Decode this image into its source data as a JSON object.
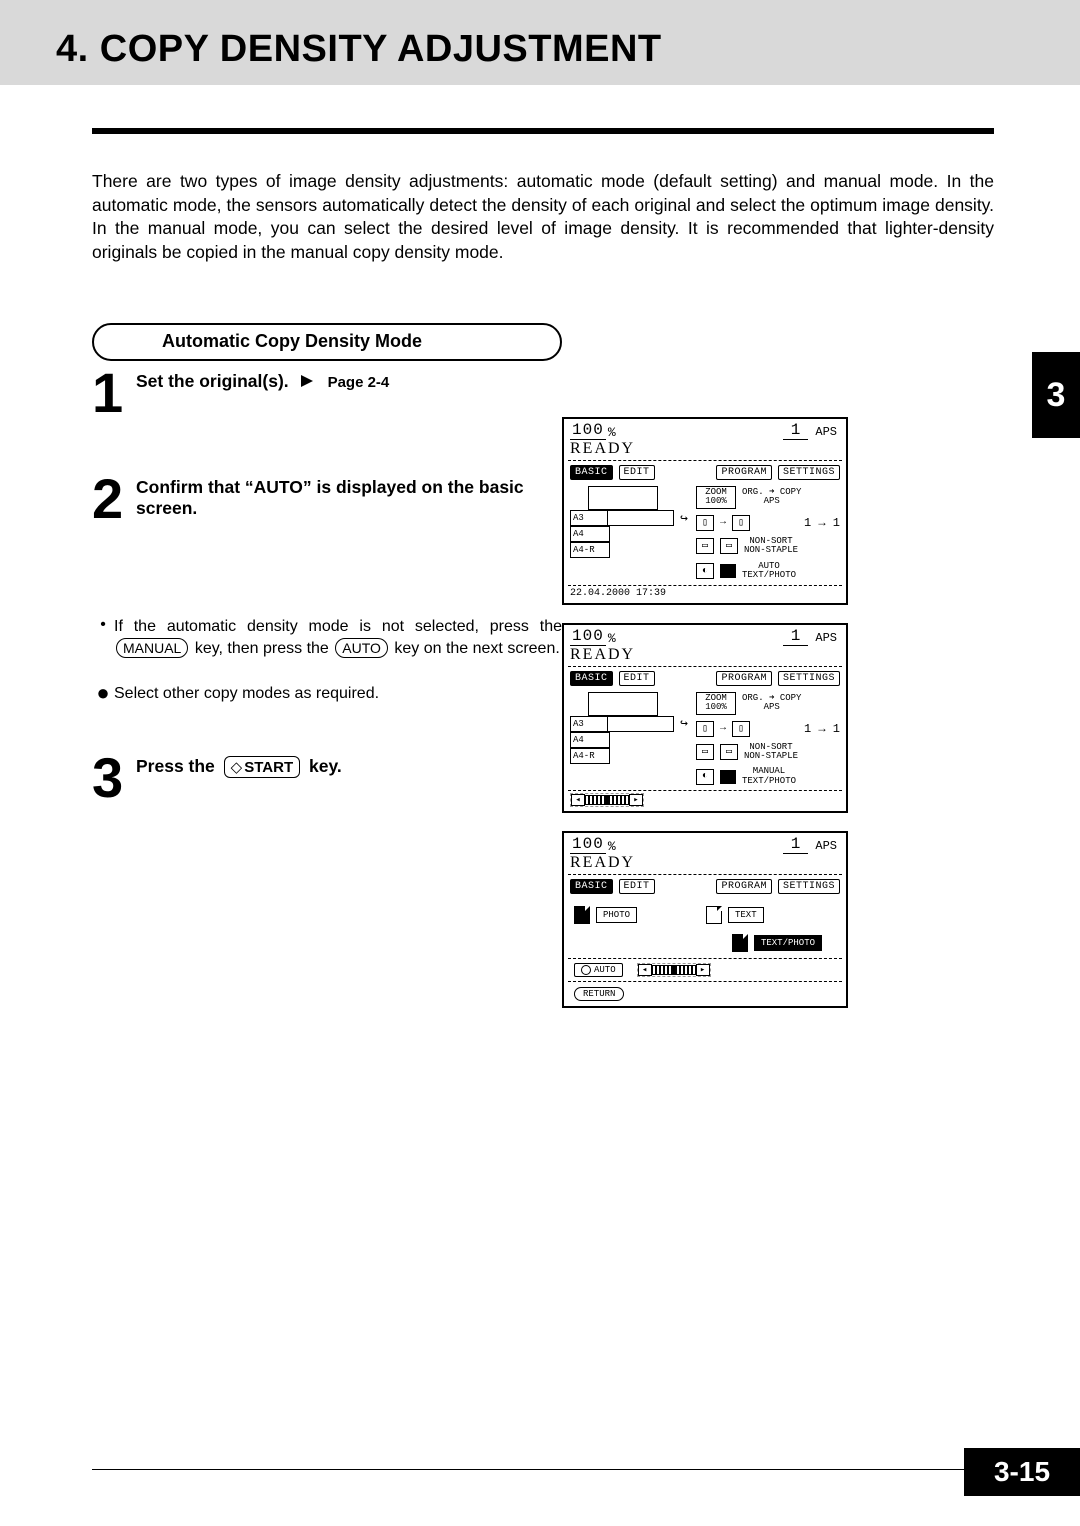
{
  "chapter_tab": "3",
  "page_number": "3-15",
  "title": "4. COPY DENSITY ADJUSTMENT",
  "intro": "There are two types of image density adjustments: automatic mode (default setting) and manual mode. In the automatic mode, the sensors automatically detect the density of each original and select the optimum image density. In the manual mode, you can select the desired level of image density. It is recommended that lighter-density originals be copied in the manual copy density mode.",
  "section_heading": "Automatic Copy Density Mode",
  "steps": {
    "s1": {
      "num": "1",
      "text": "Set the original(s).",
      "page_ref": "Page 2-4"
    },
    "s2": {
      "num": "2",
      "text": "Confirm that “AUTO” is displayed on the basic screen."
    },
    "s3": {
      "num": "3",
      "prefix": "Press the",
      "key": "START",
      "suffix": "key."
    }
  },
  "bullets": {
    "b1_a": "If the automatic density mode is not selected, press the",
    "b1_key1": "MANUAL",
    "b1_mid": "key, then press the",
    "b1_key2": "AUTO",
    "b1_b": "key on the next screen.",
    "b2": "Select other copy modes as required."
  },
  "screen_common": {
    "zoom": "100",
    "pct": "%",
    "count": "1",
    "aps": "APS",
    "ready": "READY",
    "tabs": {
      "basic": "BASIC",
      "edit": "EDIT",
      "program": "PROGRAM",
      "settings": "SETTINGS"
    },
    "trays": {
      "a3": "A3",
      "a4": "A4",
      "a4r": "A4-R"
    },
    "opts": {
      "zoom": "ZOOM\n100%",
      "org": "ORG. ➜ COPY\nAPS",
      "oneone_a": "1",
      "oneone_arrow": "→",
      "oneone_b": "1",
      "nonsort": "NON-SORT\nNON-STAPLE",
      "auto": "AUTO\nTEXT/PHOTO",
      "manual": "MANUAL\nTEXT/PHOTO"
    },
    "datetime": "22.04.2000 17:39"
  },
  "screen3": {
    "photo": "PHOTO",
    "text": "TEXT",
    "textphoto": "TEXT/PHOTO",
    "auto": "AUTO",
    "return": "RETURN"
  }
}
